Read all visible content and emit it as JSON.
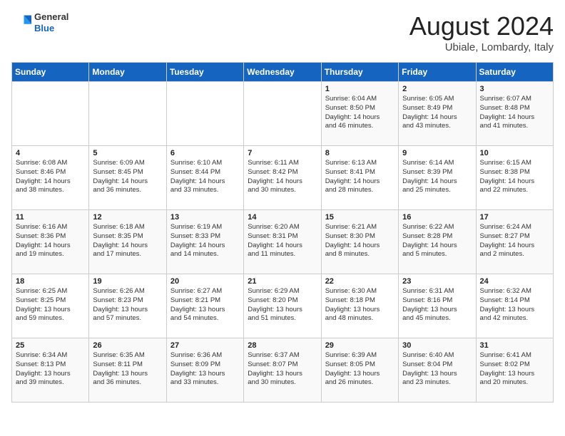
{
  "header": {
    "logo_general": "General",
    "logo_blue": "Blue",
    "title": "August 2024",
    "subtitle": "Ubiale, Lombardy, Italy"
  },
  "weekdays": [
    "Sunday",
    "Monday",
    "Tuesday",
    "Wednesday",
    "Thursday",
    "Friday",
    "Saturday"
  ],
  "weeks": [
    [
      {
        "day": "",
        "info": ""
      },
      {
        "day": "",
        "info": ""
      },
      {
        "day": "",
        "info": ""
      },
      {
        "day": "",
        "info": ""
      },
      {
        "day": "1",
        "info": "Sunrise: 6:04 AM\nSunset: 8:50 PM\nDaylight: 14 hours\nand 46 minutes."
      },
      {
        "day": "2",
        "info": "Sunrise: 6:05 AM\nSunset: 8:49 PM\nDaylight: 14 hours\nand 43 minutes."
      },
      {
        "day": "3",
        "info": "Sunrise: 6:07 AM\nSunset: 8:48 PM\nDaylight: 14 hours\nand 41 minutes."
      }
    ],
    [
      {
        "day": "4",
        "info": "Sunrise: 6:08 AM\nSunset: 8:46 PM\nDaylight: 14 hours\nand 38 minutes."
      },
      {
        "day": "5",
        "info": "Sunrise: 6:09 AM\nSunset: 8:45 PM\nDaylight: 14 hours\nand 36 minutes."
      },
      {
        "day": "6",
        "info": "Sunrise: 6:10 AM\nSunset: 8:44 PM\nDaylight: 14 hours\nand 33 minutes."
      },
      {
        "day": "7",
        "info": "Sunrise: 6:11 AM\nSunset: 8:42 PM\nDaylight: 14 hours\nand 30 minutes."
      },
      {
        "day": "8",
        "info": "Sunrise: 6:13 AM\nSunset: 8:41 PM\nDaylight: 14 hours\nand 28 minutes."
      },
      {
        "day": "9",
        "info": "Sunrise: 6:14 AM\nSunset: 8:39 PM\nDaylight: 14 hours\nand 25 minutes."
      },
      {
        "day": "10",
        "info": "Sunrise: 6:15 AM\nSunset: 8:38 PM\nDaylight: 14 hours\nand 22 minutes."
      }
    ],
    [
      {
        "day": "11",
        "info": "Sunrise: 6:16 AM\nSunset: 8:36 PM\nDaylight: 14 hours\nand 19 minutes."
      },
      {
        "day": "12",
        "info": "Sunrise: 6:18 AM\nSunset: 8:35 PM\nDaylight: 14 hours\nand 17 minutes."
      },
      {
        "day": "13",
        "info": "Sunrise: 6:19 AM\nSunset: 8:33 PM\nDaylight: 14 hours\nand 14 minutes."
      },
      {
        "day": "14",
        "info": "Sunrise: 6:20 AM\nSunset: 8:31 PM\nDaylight: 14 hours\nand 11 minutes."
      },
      {
        "day": "15",
        "info": "Sunrise: 6:21 AM\nSunset: 8:30 PM\nDaylight: 14 hours\nand 8 minutes."
      },
      {
        "day": "16",
        "info": "Sunrise: 6:22 AM\nSunset: 8:28 PM\nDaylight: 14 hours\nand 5 minutes."
      },
      {
        "day": "17",
        "info": "Sunrise: 6:24 AM\nSunset: 8:27 PM\nDaylight: 14 hours\nand 2 minutes."
      }
    ],
    [
      {
        "day": "18",
        "info": "Sunrise: 6:25 AM\nSunset: 8:25 PM\nDaylight: 13 hours\nand 59 minutes."
      },
      {
        "day": "19",
        "info": "Sunrise: 6:26 AM\nSunset: 8:23 PM\nDaylight: 13 hours\nand 57 minutes."
      },
      {
        "day": "20",
        "info": "Sunrise: 6:27 AM\nSunset: 8:21 PM\nDaylight: 13 hours\nand 54 minutes."
      },
      {
        "day": "21",
        "info": "Sunrise: 6:29 AM\nSunset: 8:20 PM\nDaylight: 13 hours\nand 51 minutes."
      },
      {
        "day": "22",
        "info": "Sunrise: 6:30 AM\nSunset: 8:18 PM\nDaylight: 13 hours\nand 48 minutes."
      },
      {
        "day": "23",
        "info": "Sunrise: 6:31 AM\nSunset: 8:16 PM\nDaylight: 13 hours\nand 45 minutes."
      },
      {
        "day": "24",
        "info": "Sunrise: 6:32 AM\nSunset: 8:14 PM\nDaylight: 13 hours\nand 42 minutes."
      }
    ],
    [
      {
        "day": "25",
        "info": "Sunrise: 6:34 AM\nSunset: 8:13 PM\nDaylight: 13 hours\nand 39 minutes."
      },
      {
        "day": "26",
        "info": "Sunrise: 6:35 AM\nSunset: 8:11 PM\nDaylight: 13 hours\nand 36 minutes."
      },
      {
        "day": "27",
        "info": "Sunrise: 6:36 AM\nSunset: 8:09 PM\nDaylight: 13 hours\nand 33 minutes."
      },
      {
        "day": "28",
        "info": "Sunrise: 6:37 AM\nSunset: 8:07 PM\nDaylight: 13 hours\nand 30 minutes."
      },
      {
        "day": "29",
        "info": "Sunrise: 6:39 AM\nSunset: 8:05 PM\nDaylight: 13 hours\nand 26 minutes."
      },
      {
        "day": "30",
        "info": "Sunrise: 6:40 AM\nSunset: 8:04 PM\nDaylight: 13 hours\nand 23 minutes."
      },
      {
        "day": "31",
        "info": "Sunrise: 6:41 AM\nSunset: 8:02 PM\nDaylight: 13 hours\nand 20 minutes."
      }
    ]
  ]
}
